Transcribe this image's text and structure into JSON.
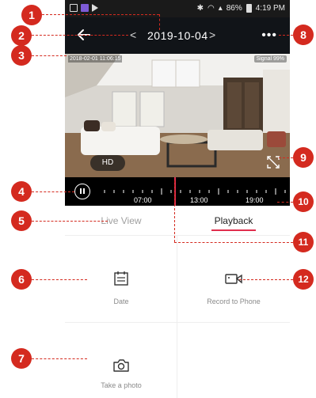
{
  "status_bar": {
    "battery": "86%",
    "time": "4:19 PM"
  },
  "header": {
    "prev": "<",
    "date": "2019-10-04",
    "next": ">",
    "more": "•••"
  },
  "video": {
    "timestamp": "2018-02-01 11:06:15",
    "signal": "Signal 99%",
    "quality_button": "HD"
  },
  "timeline": {
    "labels": [
      "07:00",
      "13:00",
      "19:00"
    ]
  },
  "tabs": {
    "live_view": "Live View",
    "playback": "Playback"
  },
  "actions": {
    "date": "Date",
    "record_to_phone": "Record to Phone",
    "take_photo": "Take a photo"
  },
  "callouts": [
    "1",
    "2",
    "3",
    "4",
    "5",
    "6",
    "7",
    "8",
    "9",
    "10",
    "11",
    "12"
  ],
  "colors": {
    "accent": "#e02e4d",
    "callout": "#d42a1f",
    "header_bg": "#111418"
  }
}
